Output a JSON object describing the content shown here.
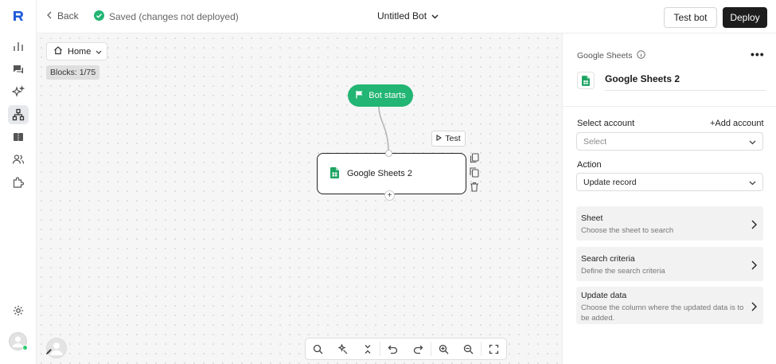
{
  "topbar": {
    "back_label": "Back",
    "status_text": "Saved (changes not deployed)",
    "bot_name": "Untitled Bot",
    "test_bot_label": "Test bot",
    "deploy_label": "Deploy"
  },
  "canvas": {
    "home_label": "Home",
    "blocks_count": "Blocks: 1/75",
    "start_node_label": "Bot starts",
    "test_chip_label": "Test",
    "node_label": "Google Sheets 2",
    "add_port_label": "+"
  },
  "panel": {
    "title": "Google Sheets",
    "more_label": "•••",
    "node_name": "Google Sheets 2",
    "account_label": "Select account",
    "add_account_label": "+Add account",
    "account_placeholder": "Select",
    "action_label": "Action",
    "action_value": "Update record",
    "cards": [
      {
        "title": "Sheet",
        "desc": "Choose the sheet to search"
      },
      {
        "title": "Search criteria",
        "desc": "Define the search criteria"
      },
      {
        "title": "Update data",
        "desc": "Choose the column where the updated data is to be added."
      }
    ]
  },
  "colors": {
    "accent_green": "#22b573",
    "deploy_bg": "#1d1d1d",
    "sheets_green": "#1fa463",
    "rail_active_bg": "#e6e8eb"
  },
  "icons": {
    "logo": "brand-logo-icon",
    "rail": [
      "analytics-icon",
      "chat-icon",
      "sparkles-icon",
      "flow-icon",
      "tickets-icon",
      "users-icon",
      "puzzle-icon",
      "settings-icon"
    ],
    "zoom_toolbar": [
      "search-icon",
      "magic-wand-icon",
      "collapse-icon",
      "undo-icon",
      "redo-icon",
      "zoom-in-icon",
      "zoom-out-icon",
      "fullscreen-icon"
    ]
  }
}
